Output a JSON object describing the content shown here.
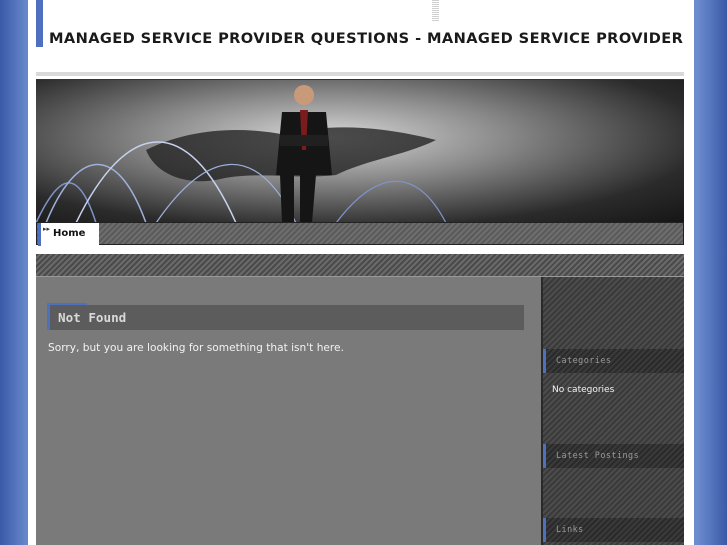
{
  "site": {
    "title": "MANAGED SERVICE PROVIDER QUESTIONS - MANAGED SERVICE PROVIDER"
  },
  "nav": {
    "items": [
      {
        "label": "Home"
      }
    ]
  },
  "post": {
    "title": "Not Found",
    "body": "Sorry, but you are looking for something that isn't here."
  },
  "sidebar": {
    "categories_heading": "Categories",
    "categories_text": "No categories",
    "latest_heading": "Latest Postings",
    "links_heading": "Links"
  },
  "colors": {
    "accent": "#4f6fbf",
    "outer_background": "#6d8ccf",
    "content_background": "#7a7a7a"
  }
}
